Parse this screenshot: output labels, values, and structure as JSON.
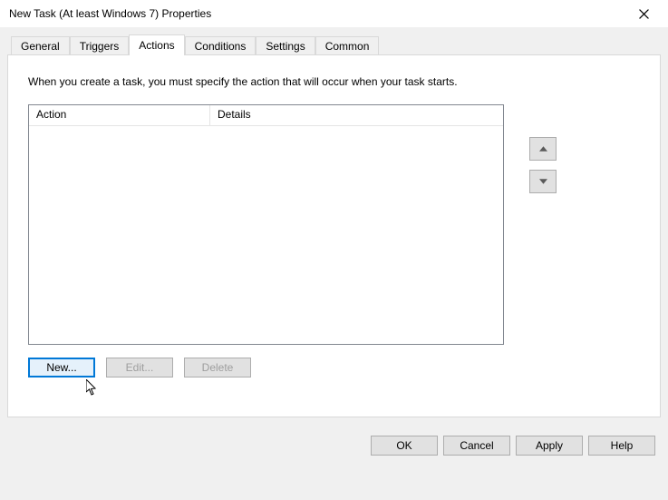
{
  "window": {
    "title": "New Task (At least Windows 7) Properties"
  },
  "tabs": {
    "general": "General",
    "triggers": "Triggers",
    "actions": "Actions",
    "conditions": "Conditions",
    "settings": "Settings",
    "common": "Common"
  },
  "panel": {
    "instruction": "When you create a task, you must specify the action that will occur when your task starts.",
    "columns": {
      "action": "Action",
      "details": "Details"
    },
    "buttons": {
      "new": "New...",
      "edit": "Edit...",
      "delete": "Delete"
    }
  },
  "dialog_buttons": {
    "ok": "OK",
    "cancel": "Cancel",
    "apply": "Apply",
    "help": "Help"
  }
}
